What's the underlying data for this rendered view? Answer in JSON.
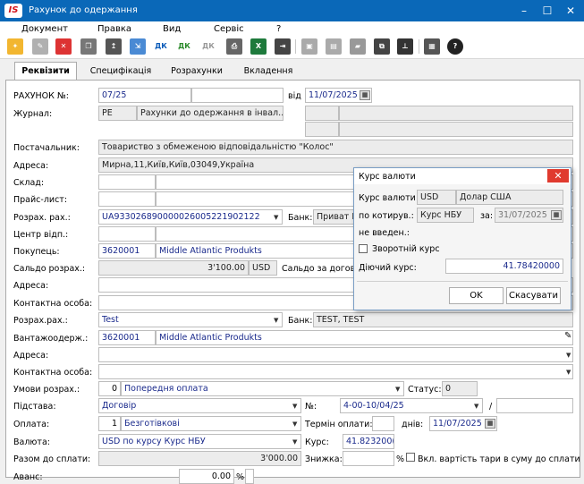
{
  "window": {
    "title": "Рахунок до одержання",
    "logo": "IS"
  },
  "menu": [
    "Документ",
    "Правка",
    "Вид",
    "Сервіс",
    "?"
  ],
  "toolbar_icons": [
    "new-doc-icon",
    "edit-doc-icon",
    "delete-doc-icon",
    "copy-doc-icon",
    "new-version-icon",
    "post-dk-icon",
    "post-dk-all-icon",
    "unpost-dk-icon",
    "print-icon",
    "export-excel-icon",
    "save-icon",
    "book-icon",
    "folder-icon",
    "link-icon",
    "tree-icon",
    "table-icon",
    "help-icon"
  ],
  "toolbar_text": {
    "dk": "ДК"
  },
  "tabs": [
    "Реквізити",
    "Специфікація",
    "Розрахунки",
    "Вкладення"
  ],
  "form": {
    "invoice_no_label": "РАХУНОК №:",
    "invoice_no": "07/25",
    "from_label": "від",
    "invoice_date": "11/07/2025",
    "journal_label": "Журнал:",
    "journal_code": "РЕ",
    "journal_name": "Рахунки до одержання в інвал...",
    "supplier_label": "Постачальник:",
    "supplier": "Товариство з обмеженою відповідальністю \"Колос\"",
    "address_label": "Адреса:",
    "address": "Мирна,11,Київ,Київ,03049,Україна",
    "warehouse_label": "Склад:",
    "pricelist_label": "Прайс-лист:",
    "account_label": "Розрах. рах.:",
    "account": "UA933026890000026005221902122",
    "bank_label": "Банк:",
    "bank": "Приват Б",
    "dept_label": "Центр відп.:",
    "buyer_label": "Покупець:",
    "buyer_code": "3620001",
    "buyer_name": "Middle Atlantic Produkts",
    "balance_label": "Сальдо розрах.:",
    "balance": "3'100.00",
    "balance_cur": "USD",
    "balance_contract_label": "Сальдо за догов",
    "address2_label": "Адреса:",
    "contact_label": "Контактна особа:",
    "account2_label": "Розрах.рах.:",
    "account2": "Test",
    "bank2_label": "Банк:",
    "bank2": "TEST, TEST",
    "consignee_label": "Вантажоодерж.:",
    "consignee_code": "3620001",
    "consignee_name": "Middle Atlantic Produkts",
    "address3_label": "Адреса:",
    "contact2_label": "Контактна особа:",
    "terms_label": "Умови розрах.:",
    "terms_code": "0",
    "terms": "Попередня оплата",
    "status_label": "Статус:",
    "status": "0",
    "basis_label": "Підстава:",
    "basis": "Договір",
    "no_label": "№:",
    "basis_no": "4-00-10/04/25",
    "slash": "/",
    "payment_label": "Оплата:",
    "payment_code": "1",
    "payment": "Безготівкові",
    "pay_term_label": "Термін оплати:",
    "days_label": "днів:",
    "pay_date": "11/07/2025",
    "currency_label": "Валюта:",
    "currency": "USD по курсу Курс НБУ",
    "rate_label": "Курс:",
    "rate": "41.823200(",
    "total_label": "Разом до сплати:",
    "total": "3'000.00",
    "discount_label": "Знижка:",
    "pct": "%",
    "tare_label": "Вкл. вартість тари в суму до сплати",
    "advance_label": "Аванс:",
    "advance": "0.00",
    "pct2": "%"
  },
  "dialog": {
    "title": "Курс валюти",
    "currency_label": "Курс валюти:",
    "currency_code": "USD",
    "currency_name": "Долар США",
    "by_rate_label": "по котирув.:",
    "rate_type": "Курс НБУ",
    "on_label": "за:",
    "rate_date": "31/07/2025",
    "not_entered": "не введен.:",
    "reverse_label": "Зворотній курс",
    "current_rate_label": "Діючий курс:",
    "current_rate": "41.78420000",
    "ok": "OK",
    "cancel": "Скасувати"
  },
  "colors": {
    "titlebar": "#0a68b8",
    "accent_red": "#d1121b",
    "field_text": "#1a2a8c"
  }
}
